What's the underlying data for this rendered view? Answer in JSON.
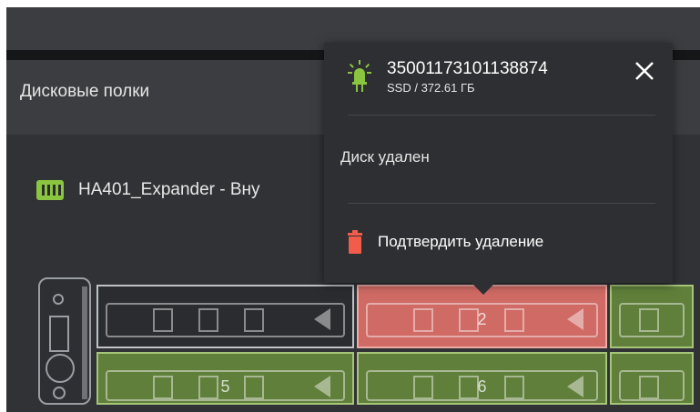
{
  "header": {
    "title": "Дисковые полки"
  },
  "shelf": {
    "name": "HA401_Expander - Вну"
  },
  "bays": [
    {
      "label": "",
      "state": "empty"
    },
    {
      "label": "2",
      "state": "removed"
    },
    {
      "label": "",
      "state": "ok"
    },
    {
      "label": "",
      "state": "ok"
    },
    {
      "label": "5",
      "state": "ok"
    },
    {
      "label": "6",
      "state": "ok"
    },
    {
      "label": "",
      "state": "ok"
    }
  ],
  "popover": {
    "disk_id": "35001173101138874",
    "disk_info": "SSD / 372.61 ГБ",
    "status": "Диск удален",
    "action_label": "Подтвердить удаление",
    "close_icon": "close-icon",
    "status_icon": "disk-led-icon",
    "action_icon": "trash-icon"
  },
  "colors": {
    "accent_green": "#8bc53f",
    "danger_red": "#f25c4b",
    "bay_ok": "#5f7f3a",
    "bay_removed": "#cf6a64"
  }
}
